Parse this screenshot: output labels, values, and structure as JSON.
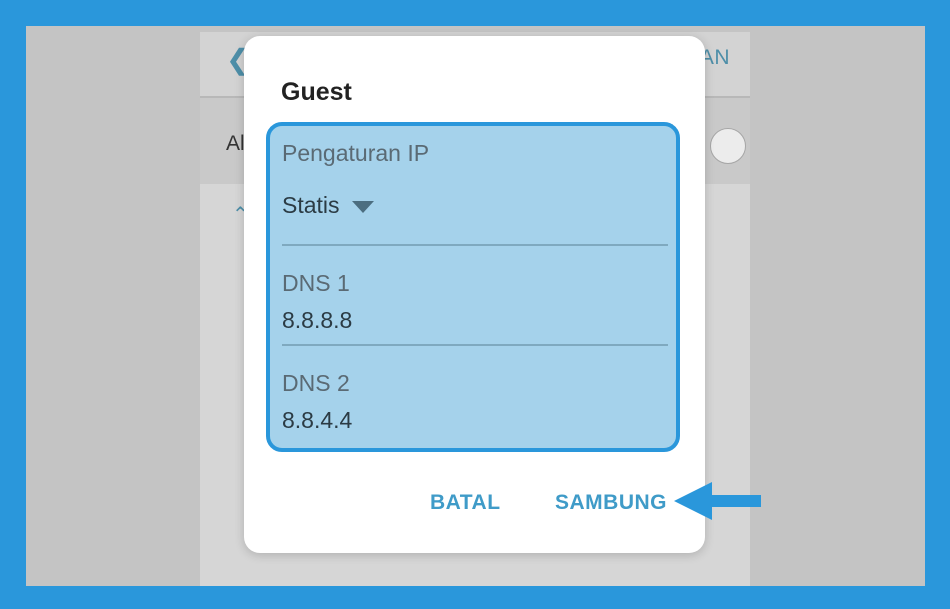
{
  "background_app": {
    "back_icon": "chevron-left-icon",
    "action_label": "AN",
    "row_label": "Al",
    "wifi_icon": "wifi-icon"
  },
  "dialog": {
    "title": "Guest",
    "ip_settings_label": "Pengaturan IP",
    "ip_settings_value": "Statis",
    "dns1_label": "DNS 1",
    "dns1_value": "8.8.8.8",
    "dns2_label": "DNS 2",
    "dns2_value": "8.8.4.4",
    "cancel_label": "BATAL",
    "connect_label": "SAMBUNG"
  },
  "colors": {
    "frame_blue": "#2a97db",
    "highlight_fill": "#a5d2eb",
    "button_text": "#3f9bc8"
  }
}
